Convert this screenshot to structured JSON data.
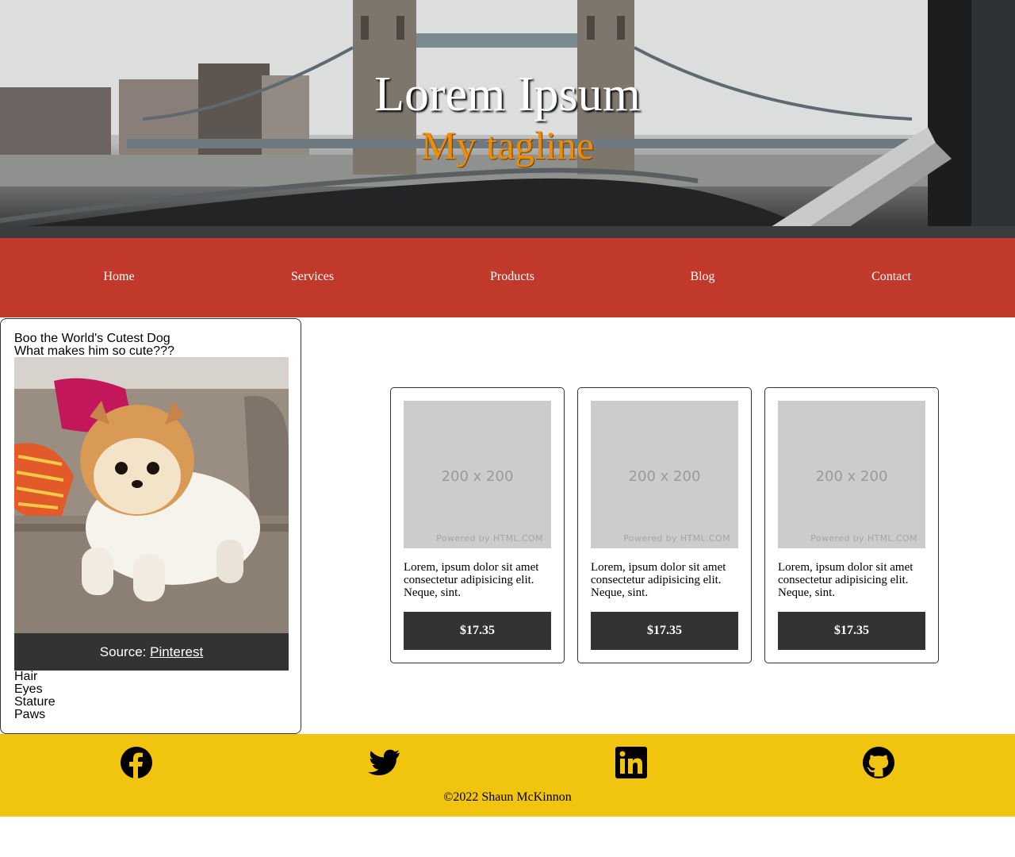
{
  "hero": {
    "title": "Lorem Ipsum",
    "tagline": "My tagline"
  },
  "nav": {
    "items": [
      {
        "label": "Home"
      },
      {
        "label": "Services"
      },
      {
        "label": "Products"
      },
      {
        "label": "Blog"
      },
      {
        "label": "Contact"
      }
    ]
  },
  "dog_card": {
    "title": "Boo the World's Cutest Dog",
    "question": "What makes him so cute???",
    "caption_prefix": "Source: ",
    "caption_link": "Pinterest",
    "traits": [
      "Hair",
      "Eyes",
      "Stature",
      "Paws"
    ]
  },
  "products": [
    {
      "placeholder_size": "200 x 200",
      "placeholder_credit": "Powered by HTML.COM",
      "description": "Lorem, ipsum dolor sit amet consectetur adipisicing elit. Neque, sint.",
      "price": "$17.35"
    },
    {
      "placeholder_size": "200 x 200",
      "placeholder_credit": "Powered by HTML.COM",
      "description": "Lorem, ipsum dolor sit amet consectetur adipisicing elit. Neque, sint.",
      "price": "$17.35"
    },
    {
      "placeholder_size": "200 x 200",
      "placeholder_credit": "Powered by HTML.COM",
      "description": "Lorem, ipsum dolor sit amet consectetur adipisicing elit. Neque, sint.",
      "price": "$17.35"
    }
  ],
  "footer": {
    "social": [
      {
        "icon": "facebook-icon"
      },
      {
        "icon": "twitter-icon"
      },
      {
        "icon": "linkedin-icon"
      },
      {
        "icon": "github-icon"
      }
    ],
    "copyright": "©2022 Shaun McKinnon"
  },
  "colors": {
    "nav_bg": "#c0392b",
    "footer_bg": "#f1c40f",
    "tagline": "#f08c00",
    "dark": "#333333"
  }
}
